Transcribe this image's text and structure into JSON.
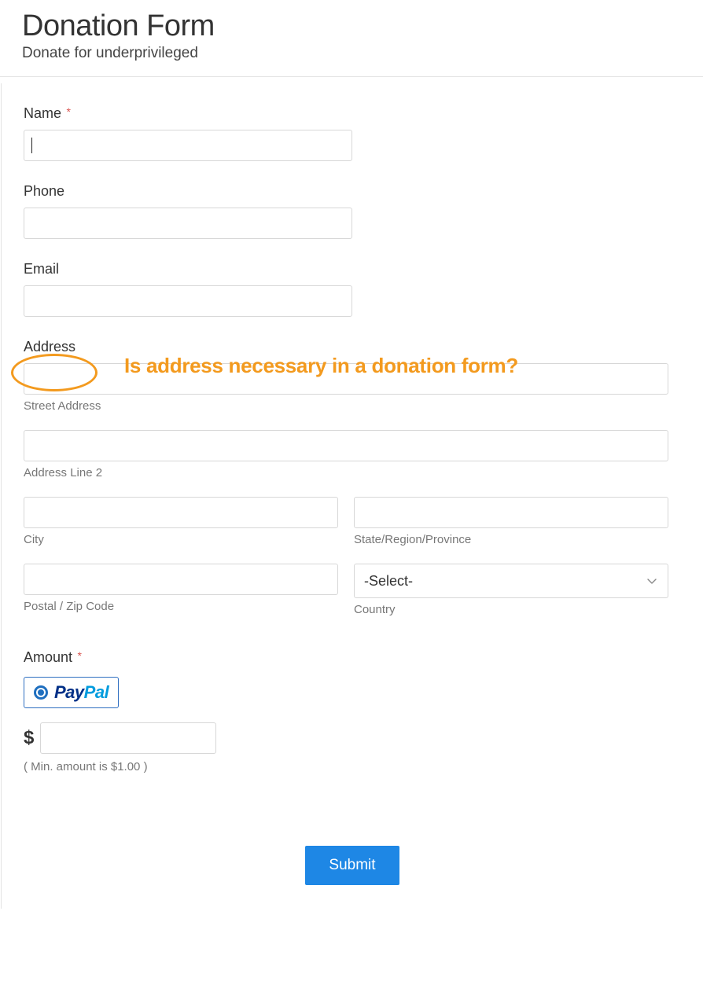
{
  "header": {
    "title": "Donation Form",
    "subtitle": "Donate for underprivileged"
  },
  "fields": {
    "name": {
      "label": "Name",
      "required_marker": "*",
      "value": ""
    },
    "phone": {
      "label": "Phone",
      "value": ""
    },
    "email": {
      "label": "Email",
      "value": ""
    },
    "address": {
      "label": "Address",
      "street": {
        "sublabel": "Street Address",
        "value": ""
      },
      "line2": {
        "sublabel": "Address Line 2",
        "value": ""
      },
      "city": {
        "sublabel": "City",
        "value": ""
      },
      "state": {
        "sublabel": "State/Region/Province",
        "value": ""
      },
      "postal": {
        "sublabel": "Postal / Zip Code",
        "value": ""
      },
      "country": {
        "sublabel": "Country",
        "selected": "-Select-"
      }
    },
    "amount": {
      "label": "Amount",
      "required_marker": "*",
      "paypal_label": "PayPal",
      "currency_symbol": "$",
      "value": "",
      "min_note": "( Min. amount is $1.00 )"
    }
  },
  "annotation": {
    "text": "Is address necessary in a donation form?"
  },
  "actions": {
    "submit": "Submit"
  }
}
